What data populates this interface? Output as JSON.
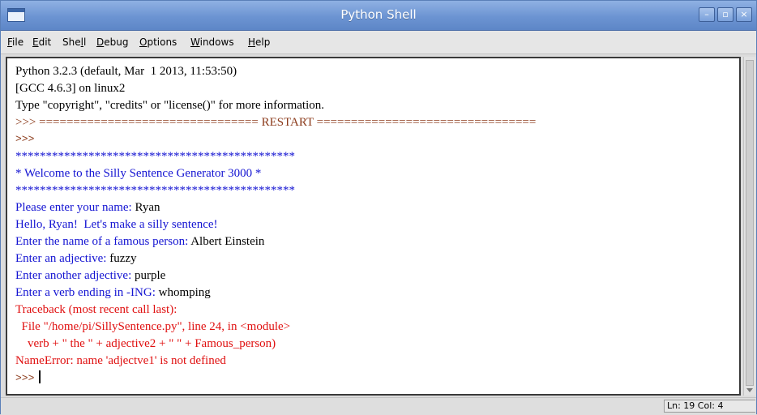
{
  "window": {
    "title": "Python Shell",
    "controls": {
      "minimize": "–",
      "maximize": "▫",
      "close": "×"
    }
  },
  "menu": [
    {
      "mnemonic": "F",
      "rest": "ile"
    },
    {
      "mnemonic": "E",
      "rest": "dit"
    },
    {
      "pre": "She",
      "mnemonic": "l",
      "rest": "l"
    },
    {
      "mnemonic": "D",
      "rest": "ebug"
    },
    {
      "mnemonic": "O",
      "rest": "ptions"
    },
    {
      "mnemonic": "W",
      "rest": "indows"
    },
    {
      "mnemonic": "H",
      "rest": "elp"
    }
  ],
  "shell": {
    "line1": "Python 3.2.3 (default, Mar  1 2013, 11:53:50)",
    "line2": "[GCC 4.6.3] on linux2",
    "line3": "Type \"copyright\", \"credits\" or \"license()\" for more information.",
    "restart": ">>> ================================ RESTART ================================",
    "prompt": ">>>",
    "stars": "**********************************************",
    "welcome": "* Welcome to the Silly Sentence Generator 3000 *",
    "name_prompt": "Please enter your name: ",
    "name_value": "Ryan",
    "hello": "Hello, Ryan!  Let's make a silly sentence!",
    "famous_prompt": "Enter the name of a famous person: ",
    "famous_value": "Albert Einstein",
    "adj_prompt": "Enter an adjective: ",
    "adj_value": "fuzzy",
    "adj2_prompt": "Enter another adjective: ",
    "adj2_value": "purple",
    "verb_prompt": "Enter a verb ending in -ING: ",
    "verb_value": "whomping",
    "tb1": "Traceback (most recent call last):",
    "tb2": "  File \"/home/pi/SillySentence.py\", line 24, in <module>",
    "tb3": "    verb + \" the \" + adjective2 + \" \" + Famous_person)",
    "tb4": "NameError: name 'adjectve1' is not defined"
  },
  "status": "Ln: 19 Col: 4",
  "colors": {
    "output_blue": "#1414d2",
    "error_red": "#e01010",
    "prompt_brown": "#8b3a1a",
    "title_blue": "#6c94d2"
  }
}
